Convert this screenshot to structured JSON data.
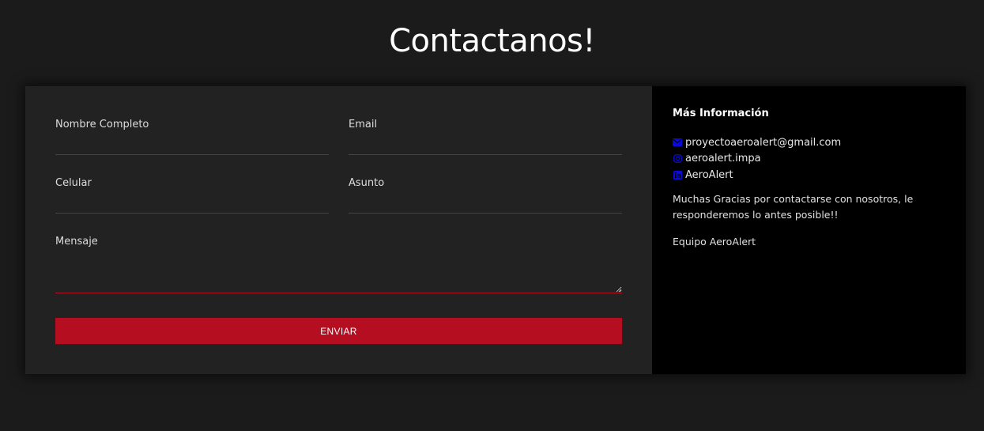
{
  "header": {
    "title": "Contactanos!"
  },
  "form": {
    "fields": {
      "nombre": {
        "label": "Nombre Completo",
        "value": ""
      },
      "email": {
        "label": "Email",
        "value": ""
      },
      "celular": {
        "label": "Celular",
        "value": ""
      },
      "asunto": {
        "label": "Asunto",
        "value": ""
      },
      "mensaje": {
        "label": "Mensaje",
        "value": ""
      }
    },
    "submit_label": "ENVIAR"
  },
  "info": {
    "heading": "Más Información",
    "contacts": [
      {
        "icon": "envelope-icon",
        "text": "proyectoaeroalert@gmail.com"
      },
      {
        "icon": "instagram-icon",
        "text": "aeroalert.impa"
      },
      {
        "icon": "linkedin-icon",
        "text": "AeroAlert"
      }
    ],
    "message": "Muchas Gracias por contactarse con nosotros, le responderemos lo antes posible!!",
    "signature": "Equipo AeroAlert"
  },
  "colors": {
    "page_background": "#1b1b1b",
    "form_background": "#222222",
    "info_background": "#000000",
    "accent_red": "#b50e20",
    "icon_blue": "#0a0ad8"
  }
}
